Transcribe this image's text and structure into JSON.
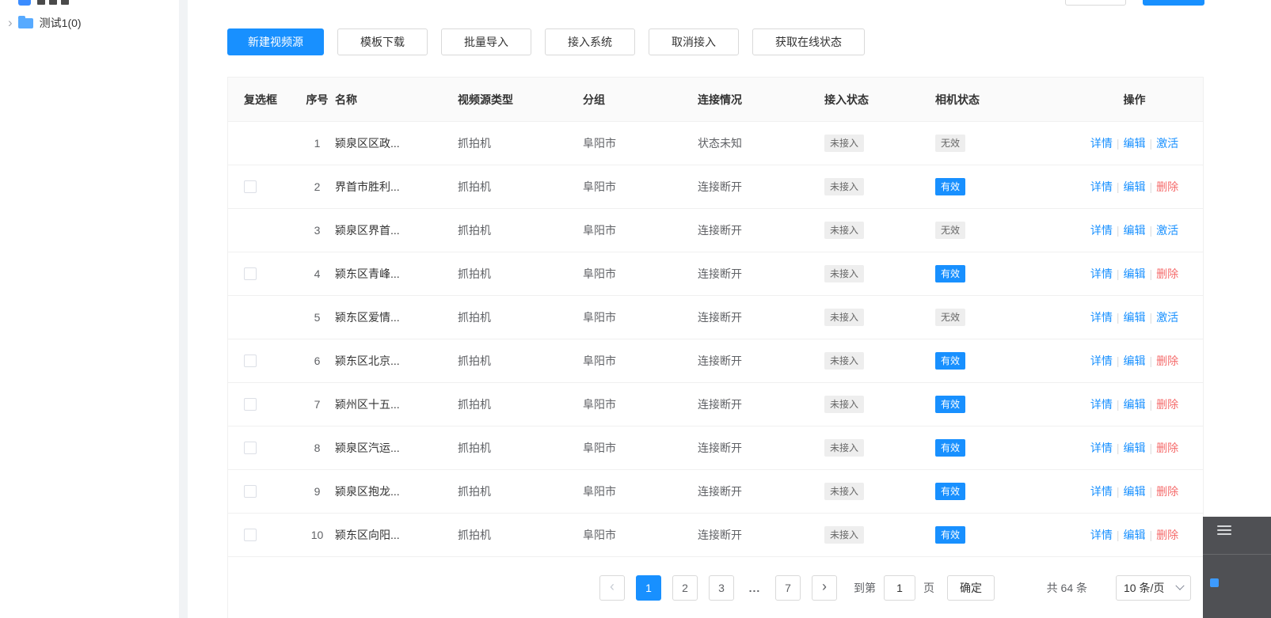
{
  "colors": {
    "primary": "#1890ff",
    "danger": "#f56c6c",
    "badge_gray_bg": "#eeeeee",
    "badge_blue_bg": "#1890ff"
  },
  "sidebar": {
    "tree_item_label": "测试1(0)"
  },
  "toolbar": {
    "buttons": [
      {
        "label": "新建视频源",
        "type": "primary"
      },
      {
        "label": "模板下载",
        "type": "default"
      },
      {
        "label": "批量导入",
        "type": "default"
      },
      {
        "label": "接入系统",
        "type": "default"
      },
      {
        "label": "取消接入",
        "type": "default"
      },
      {
        "label": "获取在线状态",
        "type": "default"
      }
    ]
  },
  "table": {
    "headers": [
      "复选框",
      "序号",
      "名称",
      "视频源类型",
      "分组",
      "连接情况",
      "接入状态",
      "相机状态",
      "操作"
    ],
    "rows": [
      {
        "index": "1",
        "name": "颍泉区区政...",
        "type": "抓拍机",
        "group": "阜阳市",
        "connection": "状态未知",
        "access": "未接入",
        "camera": {
          "label": "无效",
          "variant": "gray"
        },
        "checkbox": false,
        "actions": [
          {
            "label": "详情",
            "style": "primary"
          },
          {
            "label": "编辑",
            "style": "primary"
          },
          {
            "label": "激活",
            "style": "primary"
          }
        ]
      },
      {
        "index": "2",
        "name": "界首市胜利...",
        "type": "抓拍机",
        "group": "阜阳市",
        "connection": "连接断开",
        "access": "未接入",
        "camera": {
          "label": "有效",
          "variant": "blue"
        },
        "checkbox": true,
        "actions": [
          {
            "label": "详情",
            "style": "primary"
          },
          {
            "label": "编辑",
            "style": "primary"
          },
          {
            "label": "删除",
            "style": "danger"
          }
        ]
      },
      {
        "index": "3",
        "name": "颍泉区界首...",
        "type": "抓拍机",
        "group": "阜阳市",
        "connection": "连接断开",
        "access": "未接入",
        "camera": {
          "label": "无效",
          "variant": "gray"
        },
        "checkbox": false,
        "actions": [
          {
            "label": "详情",
            "style": "primary"
          },
          {
            "label": "编辑",
            "style": "primary"
          },
          {
            "label": "激活",
            "style": "primary"
          }
        ]
      },
      {
        "index": "4",
        "name": "颍东区青峰...",
        "type": "抓拍机",
        "group": "阜阳市",
        "connection": "连接断开",
        "access": "未接入",
        "camera": {
          "label": "有效",
          "variant": "blue"
        },
        "checkbox": true,
        "actions": [
          {
            "label": "详情",
            "style": "primary"
          },
          {
            "label": "编辑",
            "style": "primary"
          },
          {
            "label": "删除",
            "style": "danger"
          }
        ]
      },
      {
        "index": "5",
        "name": "颍东区爱情...",
        "type": "抓拍机",
        "group": "阜阳市",
        "connection": "连接断开",
        "access": "未接入",
        "camera": {
          "label": "无效",
          "variant": "gray"
        },
        "checkbox": false,
        "actions": [
          {
            "label": "详情",
            "style": "primary"
          },
          {
            "label": "编辑",
            "style": "primary"
          },
          {
            "label": "激活",
            "style": "primary"
          }
        ]
      },
      {
        "index": "6",
        "name": "颍东区北京...",
        "type": "抓拍机",
        "group": "阜阳市",
        "connection": "连接断开",
        "access": "未接入",
        "camera": {
          "label": "有效",
          "variant": "blue"
        },
        "checkbox": true,
        "actions": [
          {
            "label": "详情",
            "style": "primary"
          },
          {
            "label": "编辑",
            "style": "primary"
          },
          {
            "label": "删除",
            "style": "danger"
          }
        ]
      },
      {
        "index": "7",
        "name": "颍州区十五...",
        "type": "抓拍机",
        "group": "阜阳市",
        "connection": "连接断开",
        "access": "未接入",
        "camera": {
          "label": "有效",
          "variant": "blue"
        },
        "checkbox": true,
        "actions": [
          {
            "label": "详情",
            "style": "primary"
          },
          {
            "label": "编辑",
            "style": "primary"
          },
          {
            "label": "删除",
            "style": "danger"
          }
        ]
      },
      {
        "index": "8",
        "name": "颍泉区汽运...",
        "type": "抓拍机",
        "group": "阜阳市",
        "connection": "连接断开",
        "access": "未接入",
        "camera": {
          "label": "有效",
          "variant": "blue"
        },
        "checkbox": true,
        "actions": [
          {
            "label": "详情",
            "style": "primary"
          },
          {
            "label": "编辑",
            "style": "primary"
          },
          {
            "label": "删除",
            "style": "danger"
          }
        ]
      },
      {
        "index": "9",
        "name": "颍泉区抱龙...",
        "type": "抓拍机",
        "group": "阜阳市",
        "connection": "连接断开",
        "access": "未接入",
        "camera": {
          "label": "有效",
          "variant": "blue"
        },
        "checkbox": true,
        "actions": [
          {
            "label": "详情",
            "style": "primary"
          },
          {
            "label": "编辑",
            "style": "primary"
          },
          {
            "label": "删除",
            "style": "danger"
          }
        ]
      },
      {
        "index": "10",
        "name": "颍东区向阳...",
        "type": "抓拍机",
        "group": "阜阳市",
        "connection": "连接断开",
        "access": "未接入",
        "camera": {
          "label": "有效",
          "variant": "blue"
        },
        "checkbox": true,
        "actions": [
          {
            "label": "详情",
            "style": "primary"
          },
          {
            "label": "编辑",
            "style": "primary"
          },
          {
            "label": "删除",
            "style": "danger"
          }
        ]
      }
    ]
  },
  "pagination": {
    "pages": [
      "1",
      "2",
      "3",
      "...",
      "7"
    ],
    "active_page": "1",
    "jump_prefix": "到第",
    "jump_value": "1",
    "jump_suffix": "页",
    "confirm_label": "确定",
    "total_label": "共 64 条",
    "page_size_value": "10 条/页"
  }
}
